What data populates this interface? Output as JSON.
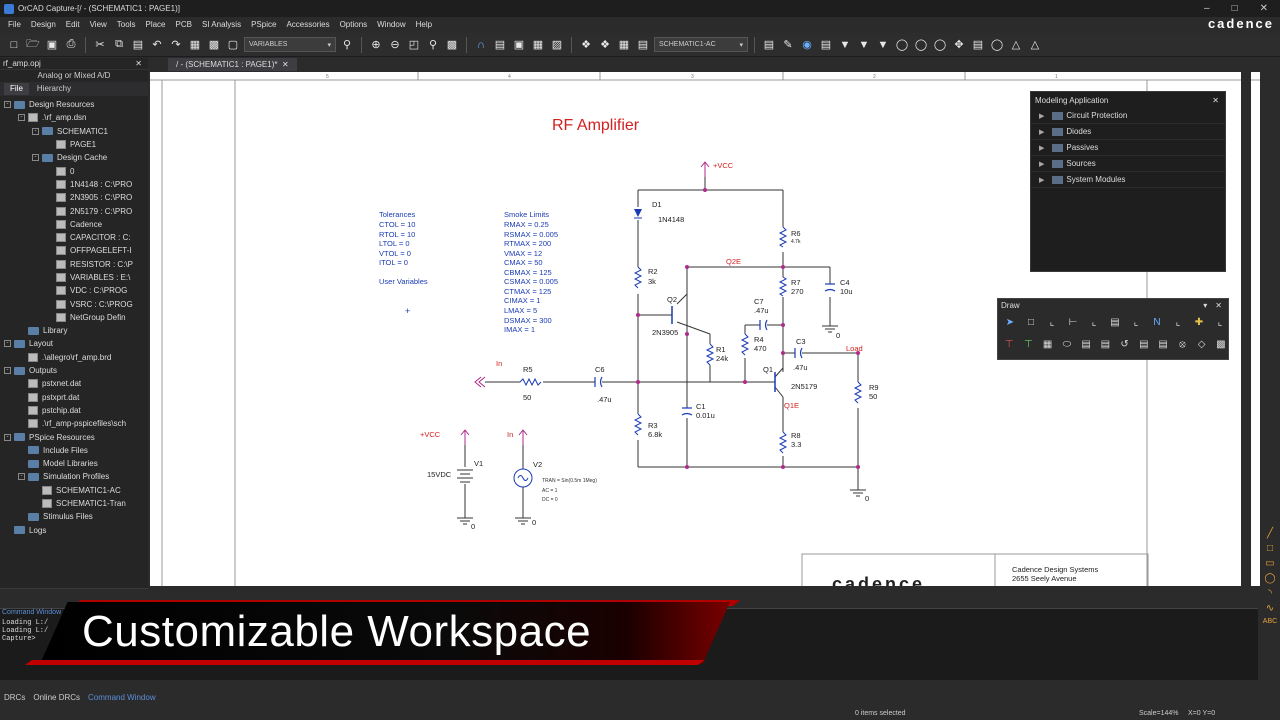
{
  "window": {
    "title": "OrCAD Capture-[/ - (SCHEMATIC1 : PAGE1)]",
    "brand": "cadence"
  },
  "menu": [
    "File",
    "Design",
    "Edit",
    "View",
    "Tools",
    "Place",
    "PCB",
    "SI Analysis",
    "PSpice",
    "Accessories",
    "Options",
    "Window",
    "Help"
  ],
  "toolbar": {
    "variables_select": "VARIABLES",
    "profile_select": "SCHEMATIC1-AC"
  },
  "project": {
    "title": "rf_amp.opj",
    "subtitle": "Analog or Mixed A/D",
    "tabs": [
      "File",
      "Hierarchy"
    ],
    "tree": [
      {
        "label": "Design Resources",
        "depth": 0,
        "type": "folder",
        "exp": "-"
      },
      {
        "label": ".\\rf_amp.dsn",
        "depth": 1,
        "type": "file",
        "exp": "-"
      },
      {
        "label": "SCHEMATIC1",
        "depth": 2,
        "type": "folder",
        "exp": "-"
      },
      {
        "label": "PAGE1",
        "depth": 3,
        "type": "file",
        "exp": ""
      },
      {
        "label": "Design Cache",
        "depth": 2,
        "type": "folder",
        "exp": "-"
      },
      {
        "label": "0",
        "depth": 3,
        "type": "file",
        "exp": ""
      },
      {
        "label": "1N4148 : C:\\PRO",
        "depth": 3,
        "type": "file",
        "exp": ""
      },
      {
        "label": "2N3905 : C:\\PRO",
        "depth": 3,
        "type": "file",
        "exp": ""
      },
      {
        "label": "2N5179 : C:\\PRO",
        "depth": 3,
        "type": "file",
        "exp": ""
      },
      {
        "label": "Cadence",
        "depth": 3,
        "type": "file",
        "exp": ""
      },
      {
        "label": "CAPACITOR : C:",
        "depth": 3,
        "type": "file",
        "exp": ""
      },
      {
        "label": "OFFPAGELEFT-I",
        "depth": 3,
        "type": "file",
        "exp": ""
      },
      {
        "label": "RESISTOR : C:\\P",
        "depth": 3,
        "type": "file",
        "exp": ""
      },
      {
        "label": "VARIABLES : E:\\",
        "depth": 3,
        "type": "file",
        "exp": ""
      },
      {
        "label": "VDC : C:\\PROG",
        "depth": 3,
        "type": "file",
        "exp": ""
      },
      {
        "label": "VSRC : C:\\PROG",
        "depth": 3,
        "type": "file",
        "exp": ""
      },
      {
        "label": "NetGroup Defin",
        "depth": 3,
        "type": "file",
        "exp": ""
      },
      {
        "label": "Library",
        "depth": 1,
        "type": "folder",
        "exp": ""
      },
      {
        "label": "Layout",
        "depth": 0,
        "type": "folder",
        "exp": "-"
      },
      {
        "label": ".\\allegro\\rf_amp.brd",
        "depth": 1,
        "type": "file",
        "exp": ""
      },
      {
        "label": "Outputs",
        "depth": 0,
        "type": "folder",
        "exp": "-"
      },
      {
        "label": "pstxnet.dat",
        "depth": 1,
        "type": "file",
        "exp": ""
      },
      {
        "label": "pstxprt.dat",
        "depth": 1,
        "type": "file",
        "exp": ""
      },
      {
        "label": "pstchip.dat",
        "depth": 1,
        "type": "file",
        "exp": ""
      },
      {
        "label": ".\\rf_amp-pspicefiles\\sch",
        "depth": 1,
        "type": "file",
        "exp": ""
      },
      {
        "label": "PSpice Resources",
        "depth": 0,
        "type": "folder",
        "exp": "-"
      },
      {
        "label": "Include Files",
        "depth": 1,
        "type": "folder",
        "exp": ""
      },
      {
        "label": "Model Libraries",
        "depth": 1,
        "type": "folder",
        "exp": ""
      },
      {
        "label": "Simulation Profiles",
        "depth": 1,
        "type": "folder",
        "exp": "-"
      },
      {
        "label": "SCHEMATIC1-AC",
        "depth": 2,
        "type": "file",
        "exp": ""
      },
      {
        "label": "SCHEMATIC1-Tran",
        "depth": 2,
        "type": "file",
        "exp": ""
      },
      {
        "label": "Stimulus Files",
        "depth": 1,
        "type": "folder",
        "exp": ""
      },
      {
        "label": "Logs",
        "depth": 0,
        "type": "folder",
        "exp": ""
      }
    ]
  },
  "doc_tab": "/ - (SCHEMATIC1 : PAGE1)*",
  "schematic": {
    "title": "RF Amplifier",
    "tolerances": [
      "Tolerances",
      "CTOL = 10",
      "RTOL = 10",
      "LTOL = 0",
      "VTOL = 0",
      "ITOL = 0"
    ],
    "user_variables": "User Variables",
    "smoke": [
      "Smoke Limits",
      "RMAX = 0.25",
      "RSMAX = 0.005",
      "RTMAX = 200",
      "VMAX = 12",
      "CMAX = 50",
      "CBMAX = 125",
      "CSMAX = 0.005",
      "CTMAX = 125",
      "CIMAX = 1",
      "LMAX = 5",
      "DSMAX = 300",
      "IMAX = 1"
    ],
    "vcc": "+VCC",
    "in_label": "In",
    "load_label": "Load",
    "net_q2e": "Q2E",
    "net_q1e": "Q1E",
    "gnd": "0",
    "v1": {
      "name": "V1",
      "value": "15VDC"
    },
    "v2": {
      "name": "V2",
      "params": [
        "TRAN = Sin(0.5m 1Meg)",
        "AC = 1",
        "DC = 0"
      ]
    },
    "parts": {
      "D1": [
        "D1",
        "1N4148"
      ],
      "R6": [
        "R6",
        "4.7k"
      ],
      "R2": [
        "R2",
        "3k"
      ],
      "Q2": [
        "Q2",
        "2N3905"
      ],
      "R7": [
        "R7",
        "270"
      ],
      "C4": [
        "C4",
        "10u"
      ],
      "C7": [
        "C7",
        ".47u"
      ],
      "R4": [
        "R4",
        "470"
      ],
      "R1": [
        "R1",
        "24k"
      ],
      "C3": [
        "C3",
        ".47u"
      ],
      "Q1": [
        "Q1",
        "2N5179"
      ],
      "R5": [
        "R5",
        "50"
      ],
      "C6": [
        "C6",
        ".47u"
      ],
      "R9": [
        "R9",
        "50"
      ],
      "C1": [
        "C1",
        "0.01u"
      ],
      "R3": [
        "R3",
        "6.8k"
      ],
      "R8": [
        "R8",
        "3.3"
      ]
    },
    "title_block": {
      "company": "Cadence Design Systems",
      "address": "2655 Seely Avenue",
      "logo": "cadence"
    },
    "grid_labels": [
      "5",
      "4",
      "3",
      "2",
      "1"
    ]
  },
  "modeling": {
    "title": "Modeling Application",
    "items": [
      "Circuit Protection",
      "Diodes",
      "Passives",
      "Sources",
      "System Modules"
    ]
  },
  "draw": {
    "title": "Draw"
  },
  "command": {
    "title": "Command Window",
    "lines": [
      "Loading L:/",
      "Loading L:/",
      "",
      "Capture>"
    ]
  },
  "banner": "Customizable Workspace",
  "bottom_tabs": [
    "DRCs",
    "Online DRCs",
    "Command Window"
  ],
  "status": {
    "selected": "0 items selected",
    "scale": "Scale=144%",
    "coords": "X=0  Y=0"
  }
}
